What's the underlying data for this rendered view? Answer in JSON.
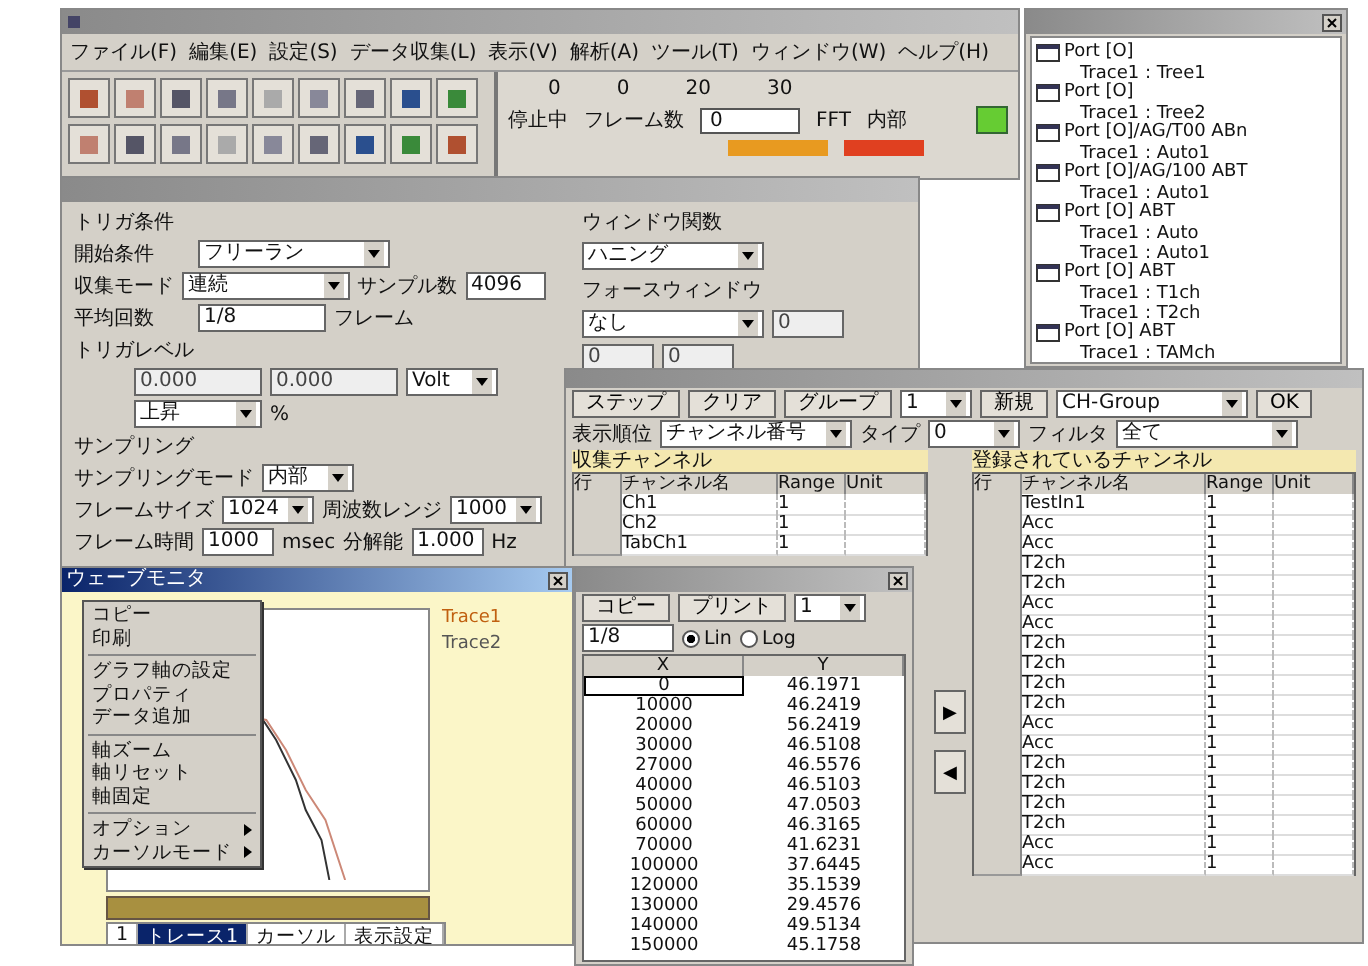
{
  "app": {
    "menu": [
      "ファイル(F)",
      "編集(E)",
      "設定(S)",
      "データ収集(L)",
      "表示(V)",
      "解析(A)",
      "ツール(T)",
      "ウィンドウ(W)",
      "ヘルプ(H)"
    ]
  },
  "monitor": {
    "values": [
      "0",
      "0",
      "20",
      "30"
    ],
    "status_label": "停止中",
    "frame_label": "フレーム数",
    "frame_value": "0",
    "fft": "FFT",
    "source": "内部",
    "progress": {
      "level": 1
    }
  },
  "tree": {
    "items": [
      {
        "label": "Port [O]",
        "children": [
          {
            "label": "Trace1 : Tree1"
          }
        ]
      },
      {
        "label": "Port [O]",
        "children": [
          {
            "label": "Trace1 : Tree2"
          }
        ]
      },
      {
        "label": "Port [O]/AG/T00 ABn",
        "children": [
          {
            "label": "Trace1 : Auto1"
          }
        ]
      },
      {
        "label": "Port [O]/AG/100 ABT",
        "children": [
          {
            "label": "Trace1 : Auto1"
          }
        ]
      },
      {
        "label": "Port [O] ABT",
        "children": [
          {
            "label": "Trace1 : Auto"
          },
          {
            "label": "Trace1 : Auto1"
          }
        ]
      },
      {
        "label": "Port [O] ABT",
        "children": [
          {
            "label": "Trace1 : T1ch"
          },
          {
            "label": "Trace1 : T2ch"
          }
        ]
      },
      {
        "label": "Port [O] ABT",
        "children": [
          {
            "label": "Trace1 : TAMch"
          }
        ]
      }
    ]
  },
  "settings": {
    "trigger": {
      "title": "トリガ条件",
      "rows": [
        {
          "label": "開始条件",
          "value": "フリーラン"
        },
        {
          "label": "収集モード",
          "value": "連続"
        }
      ],
      "rate_label": "サンプル数",
      "rate": "4096",
      "avg_label": "平均回数",
      "avg": "1/8",
      "avg_unit": "フレーム"
    },
    "level": {
      "title": "トリガレベル",
      "value": "0.000",
      "value2": "0.000",
      "unit": "Volt",
      "slope": "上昇",
      "slope_unit": "%"
    },
    "sampling": {
      "title": "サンプリング",
      "mode_label": "サンプリングモード",
      "mode": "内部",
      "size_label": "フレームサイズ",
      "size": "1024",
      "range_label": "周波数レンジ",
      "range": "1000",
      "time_label": "フレーム時間",
      "time": "1000",
      "time_unit": "msec",
      "res_label": "分解能",
      "res": "1.000",
      "res_unit": "Hz"
    },
    "window_fn": {
      "title": "ウィンドウ関数",
      "value": "ハニング"
    },
    "force": {
      "title": "フォースウィンドウ",
      "value": "なし",
      "fields": [
        "0",
        "0",
        "0"
      ]
    }
  },
  "channels": {
    "buttons": [
      "ステップ",
      "クリア",
      "グループ"
    ],
    "small_select": "1",
    "new_button": "新規",
    "preset": "CH-Group",
    "apply": "OK",
    "order_label": "表示順位",
    "order": "チャンネル番号",
    "ftype_label": "タイプ",
    "ftype": "0",
    "filter_label": "フィルタ",
    "filter": "全て",
    "left_title": "収集チャンネル",
    "right_title": "登録されているチャンネル",
    "left_columns": [
      "行",
      "チャンネル名",
      "Range",
      "Unit"
    ],
    "right_columns": [
      "行",
      "チャンネル名",
      "Range",
      "Unit"
    ],
    "left_rows": [
      {
        "name": "Ch1",
        "range": "1"
      },
      {
        "name": "Ch2",
        "range": "1"
      },
      {
        "name": "TabCh1",
        "range": "1"
      }
    ],
    "right_rows": [
      {
        "name": "TestIn1",
        "range": "1"
      },
      {
        "name": "Acc",
        "range": "1"
      },
      {
        "name": "Acc",
        "range": "1"
      },
      {
        "name": "T2ch",
        "range": "1"
      },
      {
        "name": "T2ch",
        "range": "1"
      },
      {
        "name": "Acc",
        "range": "1"
      },
      {
        "name": "Acc",
        "range": "1"
      },
      {
        "name": "T2ch",
        "range": "1"
      },
      {
        "name": "T2ch",
        "range": "1"
      },
      {
        "name": "T2ch",
        "range": "1"
      },
      {
        "name": "T2ch",
        "range": "1"
      },
      {
        "name": "Acc",
        "range": "1"
      },
      {
        "name": "Acc",
        "range": "1"
      },
      {
        "name": "T2ch",
        "range": "1"
      },
      {
        "name": "T2ch",
        "range": "1"
      },
      {
        "name": "T2ch",
        "range": "1"
      },
      {
        "name": "T2ch",
        "range": "1"
      },
      {
        "name": "Acc",
        "range": "1"
      },
      {
        "name": "Acc",
        "range": "1"
      }
    ],
    "move_buttons": [
      "▶",
      "◀"
    ]
  },
  "graph": {
    "title": "ウェーブモニタ",
    "legend": [
      "Trace1",
      "Trace2"
    ],
    "menu": [
      {
        "kind": "item",
        "label": "コピー"
      },
      {
        "kind": "item",
        "label": "印刷"
      },
      {
        "kind": "separator"
      },
      {
        "kind": "item",
        "label": "グラフ軸の設定"
      },
      {
        "kind": "item",
        "label": "プロパティ"
      },
      {
        "kind": "item",
        "label": "データ追加"
      },
      {
        "kind": "separator"
      },
      {
        "kind": "item",
        "label": "軸ズーム"
      },
      {
        "kind": "item",
        "label": "軸リセット"
      },
      {
        "kind": "item",
        "label": "軸固定"
      },
      {
        "kind": "separator"
      },
      {
        "kind": "submenu",
        "label": "オプション"
      },
      {
        "kind": "submenu",
        "label": "カーソルモード"
      }
    ],
    "tabs": [
      {
        "label": "1",
        "selected": false
      },
      {
        "label": "トレース1",
        "selected": true
      },
      {
        "label": "カーソル",
        "selected": false
      },
      {
        "label": "表示設定",
        "selected": false
      }
    ]
  },
  "datatable": {
    "buttons": [
      "コピー",
      "プリント"
    ],
    "select": "1",
    "field": "1/8",
    "radios": [
      {
        "label": "Lin",
        "selected": true
      },
      {
        "label": "Log",
        "selected": false
      }
    ],
    "columns": [
      "X",
      "Y"
    ],
    "rows": [
      [
        "0",
        "46.1971"
      ],
      [
        "10000",
        "46.2419"
      ],
      [
        "20000",
        "56.2419"
      ],
      [
        "30000",
        "46.5108"
      ],
      [
        "27000",
        "46.5576"
      ],
      [
        "40000",
        "46.5103"
      ],
      [
        "50000",
        "47.0503"
      ],
      [
        "60000",
        "46.3165"
      ],
      [
        "70000",
        "41.6231"
      ],
      [
        "100000",
        "37.6445"
      ],
      [
        "120000",
        "35.1539"
      ],
      [
        "130000",
        "29.4576"
      ],
      [
        "140000",
        "49.5134"
      ],
      [
        "150000",
        "45.1758"
      ]
    ]
  }
}
